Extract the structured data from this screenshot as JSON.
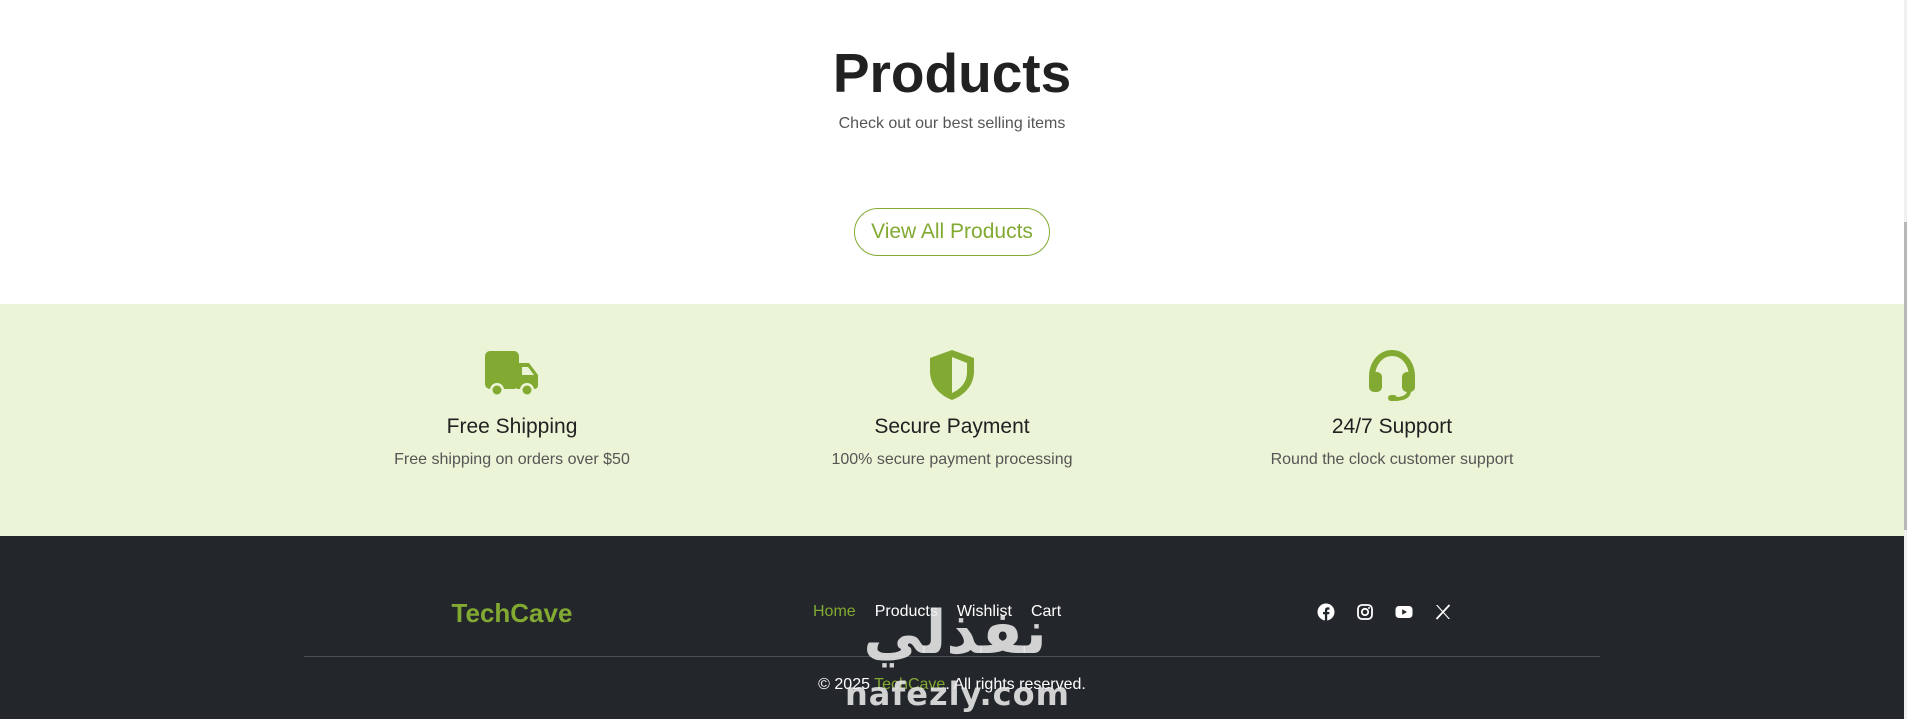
{
  "products": {
    "title": "Products",
    "subtitle": "Check out our best selling items",
    "view_all_label": "View All Products"
  },
  "features": [
    {
      "icon": "truck-icon",
      "title": "Free Shipping",
      "desc": "Free shipping on orders over $50"
    },
    {
      "icon": "shield-icon",
      "title": "Secure Payment",
      "desc": "100% secure payment processing"
    },
    {
      "icon": "headset-icon",
      "title": "24/7 Support",
      "desc": "Round the clock customer support"
    }
  ],
  "footer": {
    "brand": "TechCave",
    "nav": [
      {
        "label": "Home",
        "active": true
      },
      {
        "label": "Products",
        "active": false
      },
      {
        "label": "Wishlist",
        "active": false
      },
      {
        "label": "Cart",
        "active": false
      }
    ],
    "social": [
      "facebook-icon",
      "instagram-icon",
      "youtube-icon",
      "x-icon"
    ],
    "copyright_prefix": "© 2025 ",
    "copyright_brand": "TechCave",
    "copyright_suffix": ". All rights reserved."
  },
  "watermark": {
    "arabic": "نفذلي",
    "latin": "nafezly.com"
  },
  "colors": {
    "accent": "#82a932",
    "feature_bg": "#ecf4d7",
    "footer_bg": "#23262a"
  }
}
